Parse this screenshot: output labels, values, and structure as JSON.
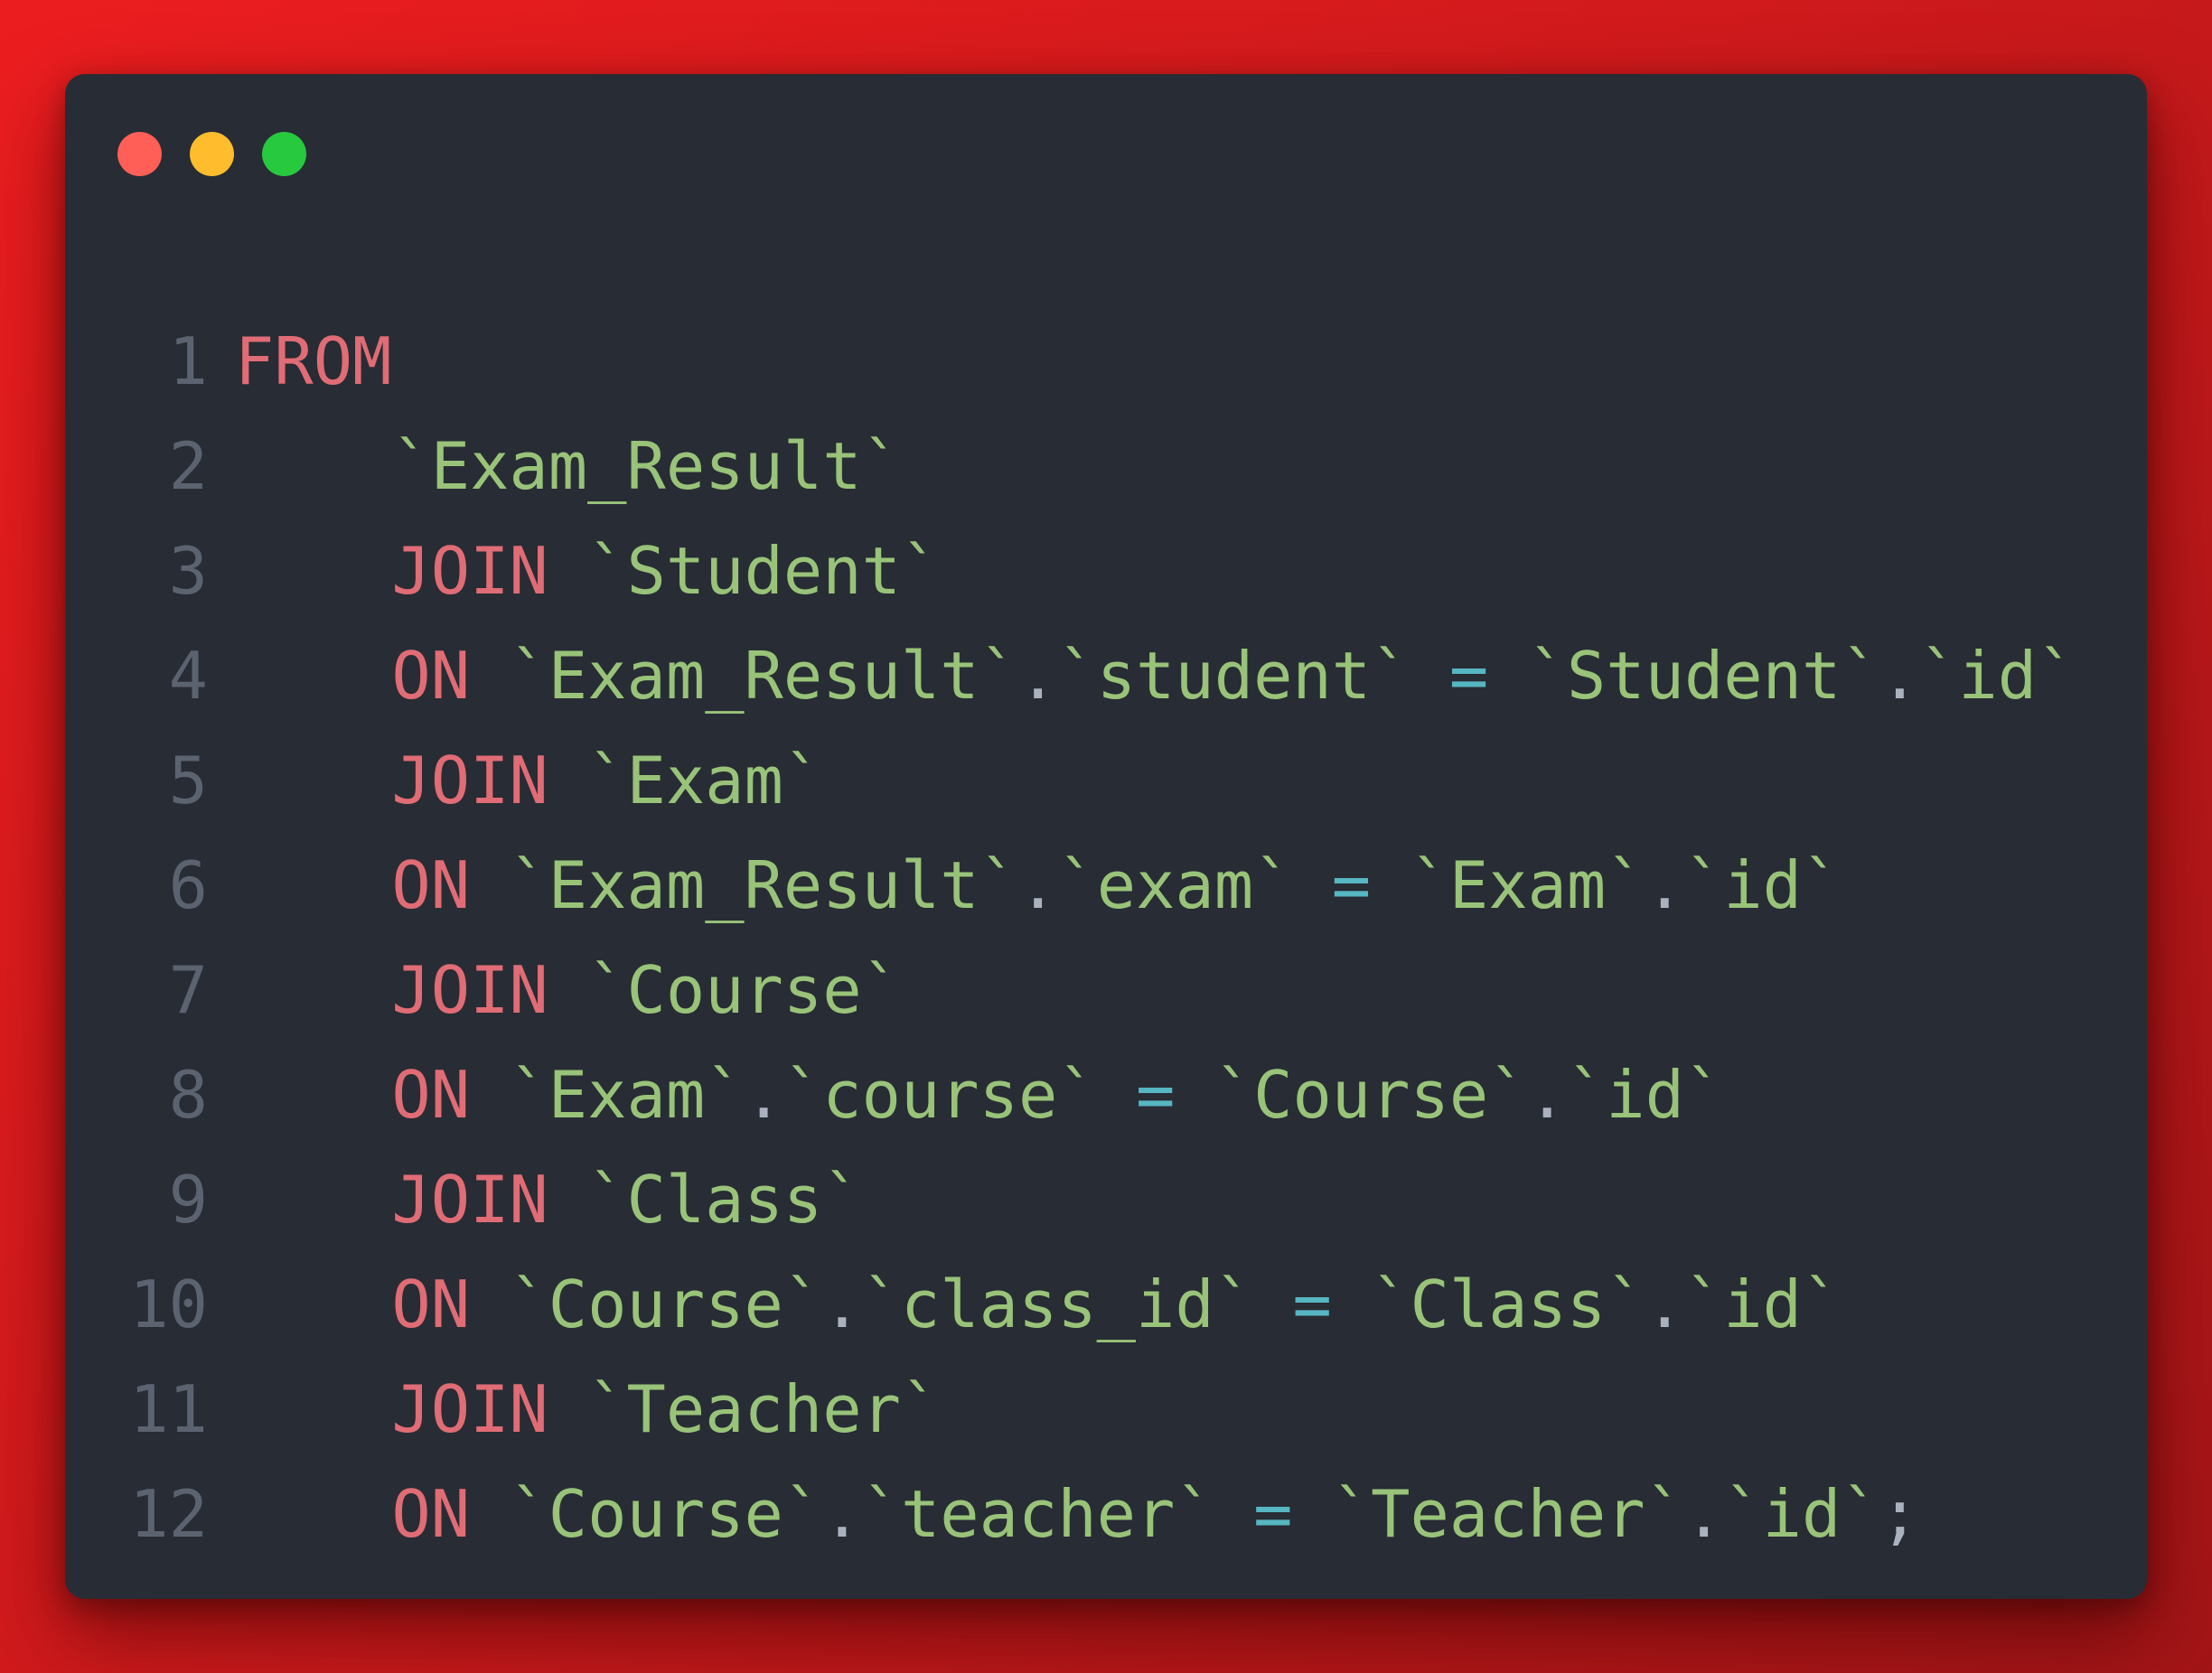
{
  "window": {
    "colors": {
      "background": "#282c34",
      "keyword": "#e06c75",
      "identifier": "#98c379",
      "operator": "#56b6c2",
      "line_number": "#5c6370",
      "page_background": "#ec1d1f"
    },
    "traffic_lights": [
      "close",
      "minimize",
      "maximize"
    ]
  },
  "code": {
    "language": "sql",
    "lines": [
      {
        "number": "1",
        "tokens": [
          {
            "t": "kw",
            "v": "FROM"
          }
        ]
      },
      {
        "number": "2",
        "tokens": [
          {
            "t": "ws",
            "v": "    "
          },
          {
            "t": "str",
            "v": "`Exam_Result`"
          }
        ]
      },
      {
        "number": "3",
        "tokens": [
          {
            "t": "ws",
            "v": "    "
          },
          {
            "t": "kw",
            "v": "JOIN"
          },
          {
            "t": "ws",
            "v": " "
          },
          {
            "t": "str",
            "v": "`Student`"
          }
        ]
      },
      {
        "number": "4",
        "tokens": [
          {
            "t": "ws",
            "v": "    "
          },
          {
            "t": "kw",
            "v": "ON"
          },
          {
            "t": "ws",
            "v": " "
          },
          {
            "t": "str",
            "v": "`Exam_Result`"
          },
          {
            "t": "punct",
            "v": "."
          },
          {
            "t": "str",
            "v": "`student`"
          },
          {
            "t": "ws",
            "v": " "
          },
          {
            "t": "op",
            "v": "="
          },
          {
            "t": "ws",
            "v": " "
          },
          {
            "t": "str",
            "v": "`Student`"
          },
          {
            "t": "punct",
            "v": "."
          },
          {
            "t": "str",
            "v": "`id`"
          }
        ]
      },
      {
        "number": "5",
        "tokens": [
          {
            "t": "ws",
            "v": "    "
          },
          {
            "t": "kw",
            "v": "JOIN"
          },
          {
            "t": "ws",
            "v": " "
          },
          {
            "t": "str",
            "v": "`Exam`"
          }
        ]
      },
      {
        "number": "6",
        "tokens": [
          {
            "t": "ws",
            "v": "    "
          },
          {
            "t": "kw",
            "v": "ON"
          },
          {
            "t": "ws",
            "v": " "
          },
          {
            "t": "str",
            "v": "`Exam_Result`"
          },
          {
            "t": "punct",
            "v": "."
          },
          {
            "t": "str",
            "v": "`exam`"
          },
          {
            "t": "ws",
            "v": " "
          },
          {
            "t": "op",
            "v": "="
          },
          {
            "t": "ws",
            "v": " "
          },
          {
            "t": "str",
            "v": "`Exam`"
          },
          {
            "t": "punct",
            "v": "."
          },
          {
            "t": "str",
            "v": "`id`"
          }
        ]
      },
      {
        "number": "7",
        "tokens": [
          {
            "t": "ws",
            "v": "    "
          },
          {
            "t": "kw",
            "v": "JOIN"
          },
          {
            "t": "ws",
            "v": " "
          },
          {
            "t": "str",
            "v": "`Course`"
          }
        ]
      },
      {
        "number": "8",
        "tokens": [
          {
            "t": "ws",
            "v": "    "
          },
          {
            "t": "kw",
            "v": "ON"
          },
          {
            "t": "ws",
            "v": " "
          },
          {
            "t": "str",
            "v": "`Exam`"
          },
          {
            "t": "punct",
            "v": "."
          },
          {
            "t": "str",
            "v": "`course`"
          },
          {
            "t": "ws",
            "v": " "
          },
          {
            "t": "op",
            "v": "="
          },
          {
            "t": "ws",
            "v": " "
          },
          {
            "t": "str",
            "v": "`Course`"
          },
          {
            "t": "punct",
            "v": "."
          },
          {
            "t": "str",
            "v": "`id`"
          }
        ]
      },
      {
        "number": "9",
        "tokens": [
          {
            "t": "ws",
            "v": "    "
          },
          {
            "t": "kw",
            "v": "JOIN"
          },
          {
            "t": "ws",
            "v": " "
          },
          {
            "t": "str",
            "v": "`Class`"
          }
        ]
      },
      {
        "number": "10",
        "tokens": [
          {
            "t": "ws",
            "v": "    "
          },
          {
            "t": "kw",
            "v": "ON"
          },
          {
            "t": "ws",
            "v": " "
          },
          {
            "t": "str",
            "v": "`Course`"
          },
          {
            "t": "punct",
            "v": "."
          },
          {
            "t": "str",
            "v": "`class_id`"
          },
          {
            "t": "ws",
            "v": " "
          },
          {
            "t": "op",
            "v": "="
          },
          {
            "t": "ws",
            "v": " "
          },
          {
            "t": "str",
            "v": "`Class`"
          },
          {
            "t": "punct",
            "v": "."
          },
          {
            "t": "str",
            "v": "`id`"
          }
        ]
      },
      {
        "number": "11",
        "tokens": [
          {
            "t": "ws",
            "v": "    "
          },
          {
            "t": "kw",
            "v": "JOIN"
          },
          {
            "t": "ws",
            "v": " "
          },
          {
            "t": "str",
            "v": "`Teacher`"
          }
        ]
      },
      {
        "number": "12",
        "tokens": [
          {
            "t": "ws",
            "v": "    "
          },
          {
            "t": "kw",
            "v": "ON"
          },
          {
            "t": "ws",
            "v": " "
          },
          {
            "t": "str",
            "v": "`Course`"
          },
          {
            "t": "punct",
            "v": "."
          },
          {
            "t": "str",
            "v": "`teacher`"
          },
          {
            "t": "ws",
            "v": " "
          },
          {
            "t": "op",
            "v": "="
          },
          {
            "t": "ws",
            "v": " "
          },
          {
            "t": "str",
            "v": "`Teacher`"
          },
          {
            "t": "punct",
            "v": "."
          },
          {
            "t": "str",
            "v": "`id`"
          },
          {
            "t": "punct",
            "v": ";"
          }
        ]
      }
    ]
  }
}
